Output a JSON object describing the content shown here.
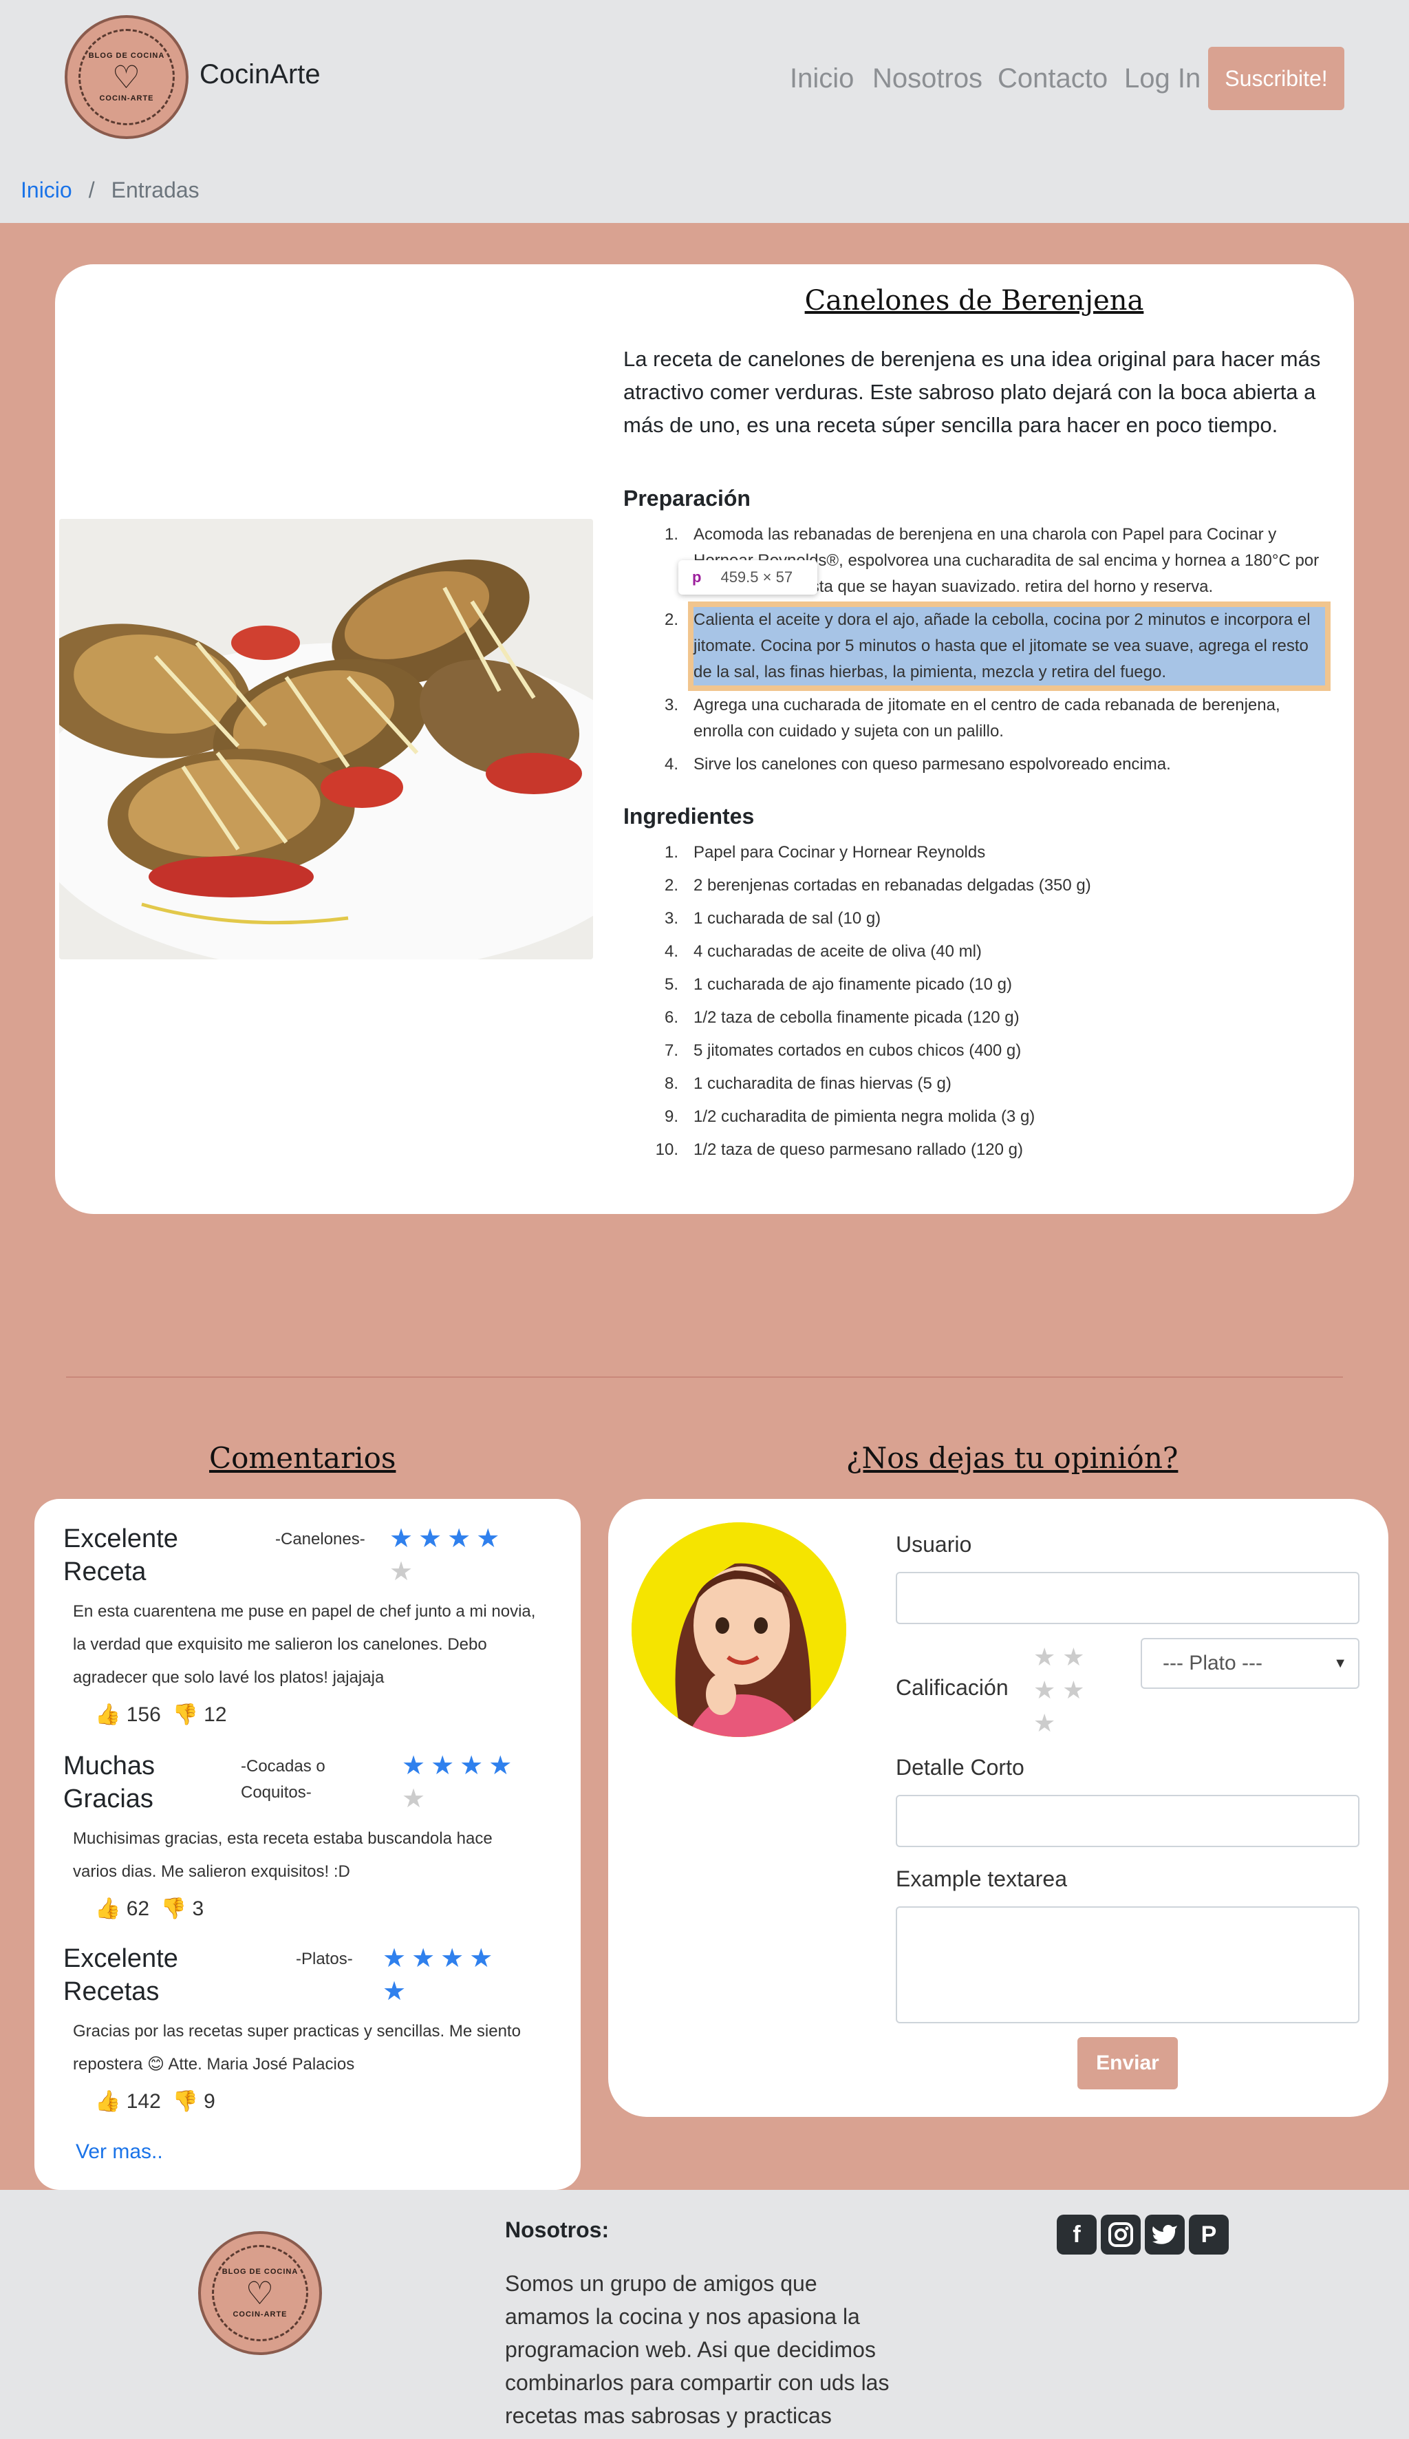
{
  "nav": {
    "brand": "CocinArte",
    "logo_text_top": "BLOG DE COCINA",
    "logo_text_bottom": "COCIN-ARTE",
    "links": [
      "Inicio",
      "Nosotros",
      "Contacto",
      "Log In"
    ],
    "subscribe": "Suscribite!"
  },
  "breadcrumb": {
    "home": "Inicio",
    "sep": "/",
    "current": "Entradas"
  },
  "recipe": {
    "title": "Canelones de Berenjena",
    "intro": "La receta de canelones de berenjena es una idea original para hacer más atractivo comer verduras. Este sabroso plato dejará con la boca abierta a más de uno, es una receta súper sencilla para hacer en poco tiempo.",
    "prep_heading": "Preparación",
    "steps": [
      "Acomoda las rebanadas de berenjena en una charola con Papel para Cocinar y Hornear Reynolds®, espolvorea una cucharadita de sal encima y hornea a 180°C por 15 minutos o hasta que se hayan suavizado. retira del horno y reserva.",
      "Calienta el aceite y dora el ajo, añade la cebolla, cocina por 2 minutos e incorpora el jitomate. Cocina por 5 minutos o hasta que el jitomate se vea suave, agrega el resto de la sal, las finas hierbas, la pimienta, mezcla y retira del fuego.",
      "Agrega una cucharada de jitomate en el centro de cada rebanada de berenjena, enrolla con cuidado y sujeta con un palillo.",
      "Sirve los canelones con queso parmesano espolvoreado encima."
    ],
    "ing_heading": "Ingredientes",
    "ingredients": [
      "Papel para Cocinar y Hornear Reynolds",
      "2 berenjenas cortadas en rebanadas delgadas (350 g)",
      "1 cucharada de sal (10 g)",
      "4 cucharadas de aceite de oliva (40 ml)",
      "1 cucharada de ajo finamente picado (10 g)",
      "1/2 taza de cebolla finamente picada (120 g)",
      "5 jitomates cortados en cubos chicos (400 g)",
      "1 cucharadita de finas hiervas (5 g)",
      "1/2 cucharadita de pimienta negra molida (3 g)",
      "1/2 taza de queso parmesano rallado (120 g)"
    ]
  },
  "inspector": {
    "tag": "p",
    "size": "459.5 × 57"
  },
  "comments": {
    "heading": "Comentarios",
    "items": [
      {
        "title": "Excelente Receta",
        "dish": "-Canelones-",
        "rating": 4,
        "body": "En esta cuarentena me puse en papel de chef junto a mi novia, la verdad que exquisito me salieron los canelones. Debo agradecer que solo lavé los platos! jajajaja",
        "likes": "156",
        "dislikes": "12"
      },
      {
        "title": "Muchas Gracias",
        "dish": "-Cocadas o Coquitos-",
        "rating": 4,
        "body": "Muchisimas gracias, esta receta estaba buscandola hace varios dias. Me salieron exquisitos! :D",
        "likes": "62",
        "dislikes": "3"
      },
      {
        "title": "Excelente Recetas",
        "dish": "-Platos-",
        "rating": 5,
        "body": "Gracias por las recetas super practicas y sencillas. Me siento repostera 😊 Atte. Maria José Palacios",
        "likes": "142",
        "dislikes": "9"
      }
    ],
    "more": "Ver mas.."
  },
  "form": {
    "heading": "¿Nos dejas tu opinión?",
    "user_label": "Usuario",
    "rating_label": "Calificación",
    "dish_select": "--- Plato ---",
    "detail_label": "Detalle Corto",
    "textarea_label": "Example textarea",
    "submit": "Enviar"
  },
  "footer": {
    "heading": "Nosotros:",
    "text": "Somos un grupo de amigos que amamos la cocina y nos apasiona la programacion web. Asi que decidimos combinarlos para compartir con uds las recetas mas sabrosas y practicas",
    "social": [
      "facebook-icon",
      "instagram-icon",
      "twitter-icon",
      "pinterest-icon"
    ]
  },
  "colors": {
    "accent": "#d9a291",
    "link": "#1a73e8",
    "star": "#2f80ed",
    "header_bg": "#e4e5e7"
  }
}
